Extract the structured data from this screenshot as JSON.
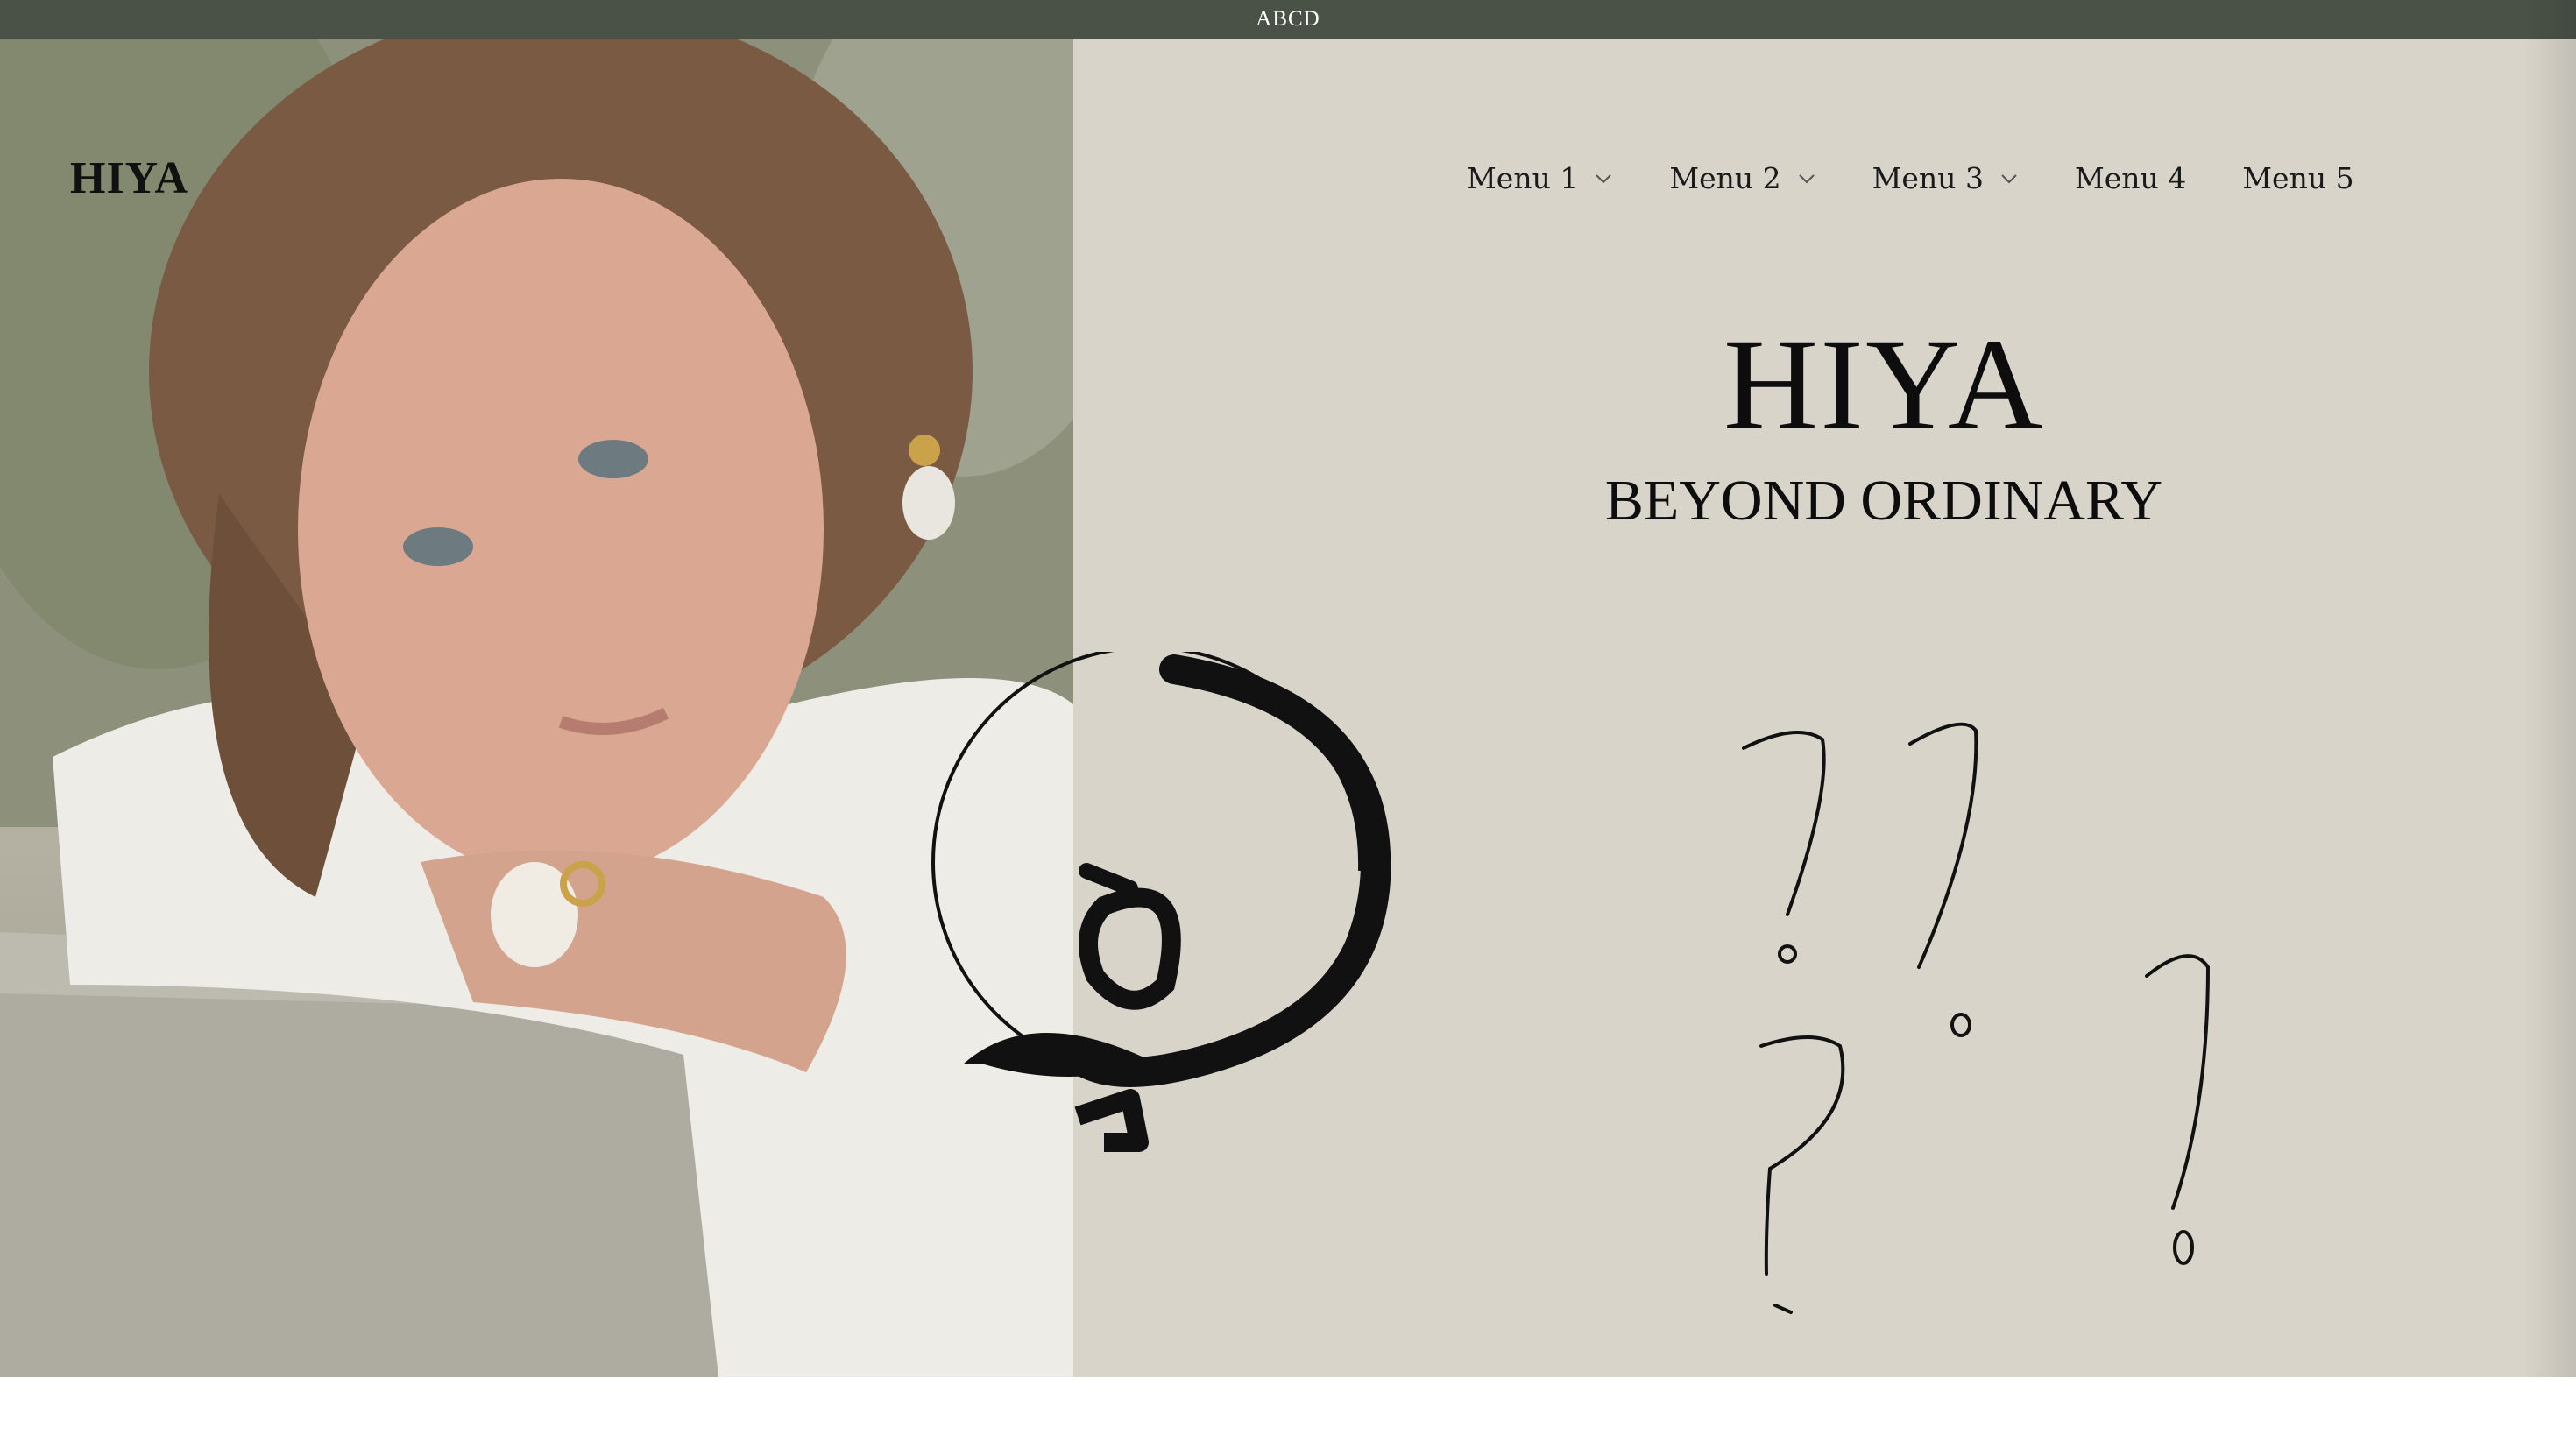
{
  "announcement": {
    "text": "ABCD"
  },
  "header": {
    "logo": "HIYA",
    "nav": [
      {
        "label": "Menu 1",
        "has_dropdown": true
      },
      {
        "label": "Menu 2",
        "has_dropdown": true
      },
      {
        "label": "Menu 3",
        "has_dropdown": true
      },
      {
        "label": "Menu 4",
        "has_dropdown": false
      },
      {
        "label": "Menu 5",
        "has_dropdown": false
      }
    ]
  },
  "hero": {
    "title": "HIYA",
    "subtitle": "BEYOND ORDINARY",
    "photo_icon": "portrait-photo",
    "emblem_icon": "calligraphy-emblem-icon",
    "doodle_icon": "question-mark-doodles-icon"
  },
  "colors": {
    "announcement_bg": "#4a5248",
    "hero_bg": "#d8d4ca",
    "text": "#111111"
  }
}
